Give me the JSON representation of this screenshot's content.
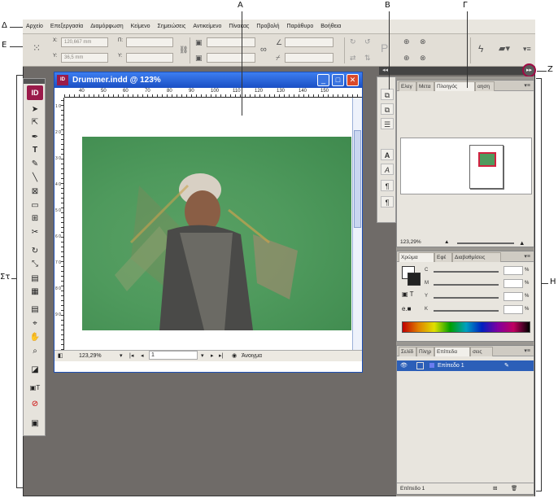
{
  "callouts": {
    "a": "A",
    "b": "B",
    "c": "Γ",
    "d": "Δ",
    "e": "E",
    "st": "Στ",
    "z": "Z",
    "h": "H"
  },
  "menubar": {
    "items": [
      "Αρχείο",
      "Επεξεργασία",
      "Διαμόρφωση",
      "Κείμενο",
      "Σημειώσεις",
      "Αντικείμενο",
      "Πίνακας",
      "Προβολή",
      "Παράθυρο",
      "Βοήθεια"
    ]
  },
  "control": {
    "x_label": "X:",
    "y_label": "Y:",
    "x_value": "120,667 mm",
    "y_value": "36,5 mm",
    "w_label": "Π:",
    "h_label": "Υ:"
  },
  "tools": {
    "logo": "ID"
  },
  "document": {
    "title": "Drummer.indd @ 123%",
    "icon": "ID",
    "ruler_marks": [
      "40",
      "50",
      "60",
      "70",
      "80",
      "90",
      "100",
      "110",
      "120",
      "130",
      "140",
      "150"
    ],
    "ruler_side": [
      "1 0",
      "2 0",
      "3 0",
      "4 0",
      "5 0",
      "6 0",
      "7 0",
      "8 0",
      "9 0"
    ],
    "zoom": "123,29%",
    "page": "1",
    "status": "Άνοιγμα"
  },
  "panels": {
    "navigator_tabs": [
      "Ελεγ",
      "Μετα",
      "Πλοηγός",
      "αηση"
    ],
    "navigator_zoom": "123,29%",
    "color_tabs": [
      "Χρώμα",
      "Εφέ",
      "Διαβαθμίσεις"
    ],
    "color_channels": [
      "C",
      "M",
      "Y",
      "K"
    ],
    "layers_tabs": [
      "Σελίδ",
      "Πληρ",
      "Επίπεδα",
      "σεις"
    ],
    "layer_name": "Επίπεδο 1",
    "layers_footer": "Επίπεδο 1"
  },
  "colors": {
    "accent": "#9a1a4a",
    "titlebar": "#1a4fc4",
    "photo_bg": "#4f9a5d",
    "highlight": "#a00a44"
  }
}
